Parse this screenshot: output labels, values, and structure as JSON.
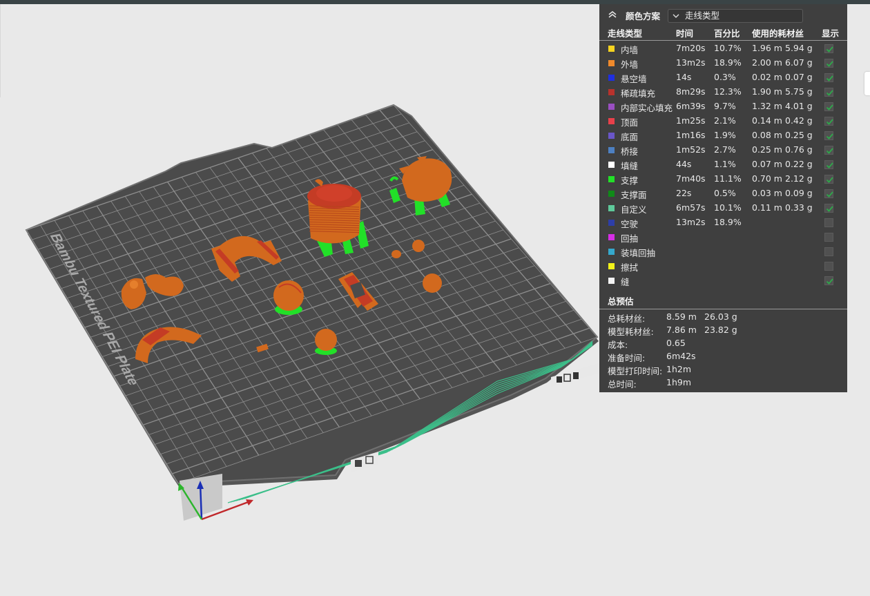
{
  "legend": {
    "scheme_label": "颜色方案",
    "scheme_value": "走线类型",
    "columns": {
      "type": "走线类型",
      "time": "时间",
      "percent": "百分比",
      "filament": "使用的耗材丝",
      "show": "显示"
    },
    "rows": [
      {
        "name": "内墙",
        "color": "#f5d320",
        "time": "7m20s",
        "percent": "10.7%",
        "length": "1.96 m",
        "weight": "5.94 g",
        "checked": true
      },
      {
        "name": "外墙",
        "color": "#f08a2c",
        "time": "13m2s",
        "percent": "18.9%",
        "length": "2.00 m",
        "weight": "6.07 g",
        "checked": true
      },
      {
        "name": "悬空墙",
        "color": "#1f2fe0",
        "time": "14s",
        "percent": "0.3%",
        "length": "0.02 m",
        "weight": "0.07 g",
        "checked": true
      },
      {
        "name": "稀疏填充",
        "color": "#b8322c",
        "time": "8m29s",
        "percent": "12.3%",
        "length": "1.90 m",
        "weight": "5.75 g",
        "checked": true
      },
      {
        "name": "内部实心填充",
        "color": "#9a4fc2",
        "time": "6m39s",
        "percent": "9.7%",
        "length": "1.32 m",
        "weight": "4.01 g",
        "checked": true
      },
      {
        "name": "顶面",
        "color": "#e8404a",
        "time": "1m25s",
        "percent": "2.1%",
        "length": "0.14 m",
        "weight": "0.42 g",
        "checked": true
      },
      {
        "name": "底面",
        "color": "#6a56c8",
        "time": "1m16s",
        "percent": "1.9%",
        "length": "0.08 m",
        "weight": "0.25 g",
        "checked": true
      },
      {
        "name": "桥接",
        "color": "#4d80c2",
        "time": "1m52s",
        "percent": "2.7%",
        "length": "0.25 m",
        "weight": "0.76 g",
        "checked": true
      },
      {
        "name": "填缝",
        "color": "#ffffff",
        "time": "44s",
        "percent": "1.1%",
        "length": "0.07 m",
        "weight": "0.22 g",
        "checked": true
      },
      {
        "name": "支撑",
        "color": "#22e028",
        "time": "7m40s",
        "percent": "11.1%",
        "length": "0.70 m",
        "weight": "2.12 g",
        "checked": true
      },
      {
        "name": "支撑面",
        "color": "#0f8a18",
        "time": "22s",
        "percent": "0.5%",
        "length": "0.03 m",
        "weight": "0.09 g",
        "checked": true
      },
      {
        "name": "自定义",
        "color": "#5ec99a",
        "time": "6m57s",
        "percent": "10.1%",
        "length": "0.11 m",
        "weight": "0.33 g",
        "checked": true
      },
      {
        "name": "空驶",
        "color": "#2d3ea8",
        "time": "13m2s",
        "percent": "18.9%",
        "length": "",
        "weight": "",
        "checked": false
      },
      {
        "name": "回抽",
        "color": "#d62ee6",
        "time": "",
        "percent": "",
        "length": "",
        "weight": "",
        "checked": false
      },
      {
        "name": "装填回抽",
        "color": "#35a8cc",
        "time": "",
        "percent": "",
        "length": "",
        "weight": "",
        "checked": false
      },
      {
        "name": "擦拭",
        "color": "#f2f21a",
        "time": "",
        "percent": "",
        "length": "",
        "weight": "",
        "checked": false
      },
      {
        "name": "缝",
        "color": "#f4f4f4",
        "time": "",
        "percent": "",
        "length": "",
        "weight": "",
        "checked": true
      }
    ]
  },
  "estimate": {
    "title": "总预估",
    "rows": [
      {
        "label": "总耗材丝:",
        "v1": "8.59 m",
        "v2": "26.03 g"
      },
      {
        "label": "模型耗材丝:",
        "v1": "7.86 m",
        "v2": "23.82 g"
      },
      {
        "label": "成本:",
        "v1": "0.65",
        "v2": ""
      },
      {
        "label": "准备时间:",
        "v1": "6m42s",
        "v2": ""
      },
      {
        "label": "模型打印时间:",
        "v1": "1h2m",
        "v2": ""
      },
      {
        "label": "总时间:",
        "v1": "1h9m",
        "v2": ""
      }
    ]
  },
  "plate": {
    "label": "Bambu Textured PEI Plate",
    "plate_color": "#4b4b4b",
    "grid_color": "#8f8f8f",
    "model_color": "#d2691e",
    "support_color": "#22e028"
  }
}
